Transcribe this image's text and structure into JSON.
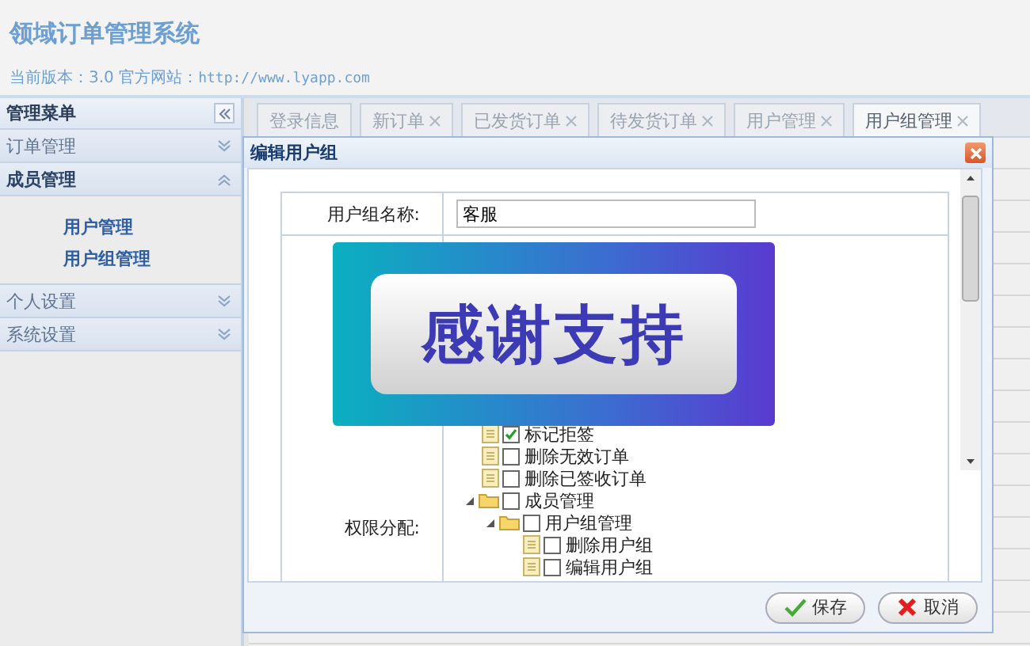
{
  "header": {
    "title": "领域订单管理系统",
    "version": "当前版本：3.0 官方网站：",
    "website": "http://www.lyapp.com"
  },
  "sidebar": {
    "title": "管理菜单",
    "sections": [
      {
        "label": "订单管理",
        "expanded": false
      },
      {
        "label": "成员管理",
        "expanded": true,
        "items": [
          {
            "label": "用户管理"
          },
          {
            "label": "用户组管理"
          }
        ]
      },
      {
        "label": "个人设置",
        "expanded": false
      },
      {
        "label": "系统设置",
        "expanded": false
      }
    ]
  },
  "tabs": [
    {
      "label": "登录信息",
      "closable": false,
      "selected": false
    },
    {
      "label": "新订单",
      "closable": true,
      "selected": false
    },
    {
      "label": "已发货订单",
      "closable": true,
      "selected": false
    },
    {
      "label": "待发货订单",
      "closable": true,
      "selected": false
    },
    {
      "label": "用户管理",
      "closable": true,
      "selected": false
    },
    {
      "label": "用户组管理",
      "closable": true,
      "selected": true
    }
  ],
  "dialog": {
    "title": "编辑用户组",
    "name_label": "用户组名称:",
    "name_value": "客服",
    "perm_label": "权限分配:",
    "banner": {
      "text": "感谢支持"
    },
    "tree": [
      {
        "label": "标记拒签",
        "kind": "file",
        "checked": true
      },
      {
        "label": "删除无效订单",
        "kind": "file",
        "checked": false
      },
      {
        "label": "删除已签收订单",
        "kind": "file",
        "checked": false
      },
      {
        "label": "成员管理",
        "kind": "folder",
        "checked": false,
        "expanded": true,
        "children": [
          {
            "label": "用户组管理",
            "kind": "folder",
            "checked": false,
            "expanded": true,
            "children": [
              {
                "label": "删除用户组",
                "kind": "file",
                "checked": false
              },
              {
                "label": "编辑用户组",
                "kind": "file",
                "checked": false
              }
            ]
          }
        ]
      }
    ],
    "buttons": [
      {
        "label": "保存",
        "kind": "ok"
      },
      {
        "label": "取消",
        "kind": "cancel"
      }
    ]
  }
}
